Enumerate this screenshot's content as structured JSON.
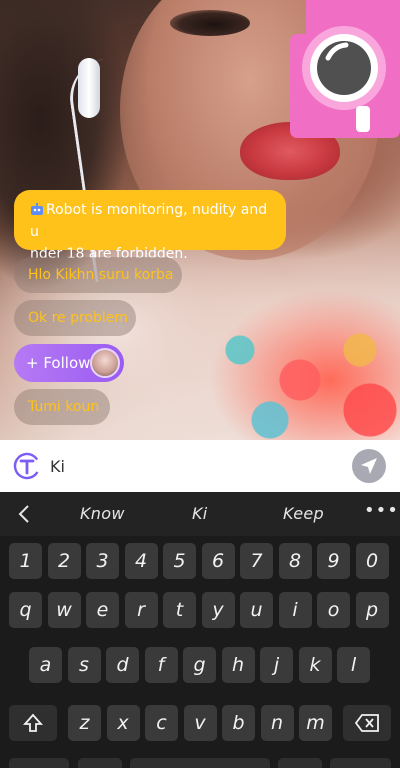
{
  "chat": {
    "notice": "Robot is monitoring, nudity and under 18 are forbidden.",
    "notice_line1": "Robot is monitoring, nudity and u",
    "notice_line2": "nder 18 are forbidden.",
    "messages": [
      "Hlo Kikhn suru korba",
      "Ok re problem",
      "Tumi koun"
    ],
    "follow_label": "+ Follow"
  },
  "input": {
    "value": "Ki"
  },
  "keyboard": {
    "suggestions": [
      "Know",
      "Ki",
      "Keep"
    ],
    "more": "•••",
    "numbers": [
      "1",
      "2",
      "3",
      "4",
      "5",
      "6",
      "7",
      "8",
      "9",
      "0"
    ],
    "row1": [
      "q",
      "w",
      "e",
      "r",
      "t",
      "y",
      "u",
      "i",
      "o",
      "p"
    ],
    "row2": [
      "a",
      "s",
      "d",
      "f",
      "g",
      "h",
      "j",
      "k",
      "l"
    ],
    "row3": [
      "z",
      "x",
      "c",
      "v",
      "b",
      "n",
      "m"
    ]
  },
  "colors": {
    "notice_bg": "#ffc21a",
    "follow_bg": "#a765f2",
    "camera_pink": "#f06ec3",
    "keyboard_bg": "#1b1b1b"
  }
}
